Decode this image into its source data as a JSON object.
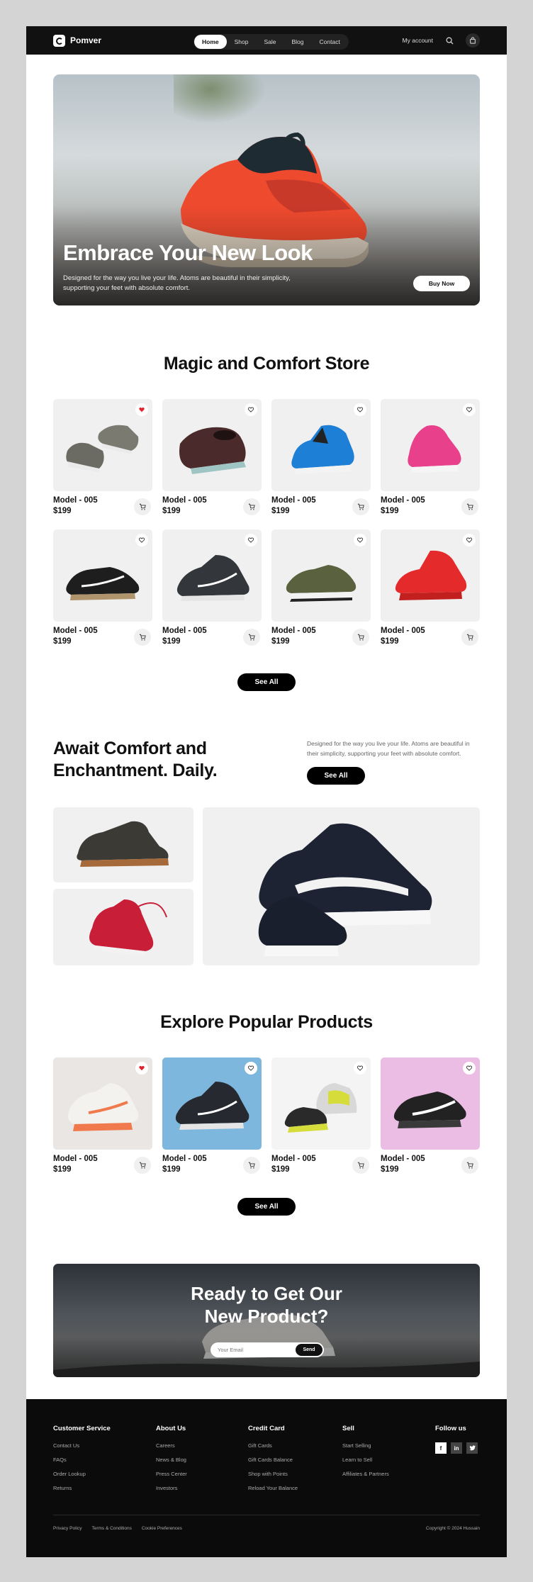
{
  "nav": {
    "brand": "Pomver",
    "links": [
      "Home",
      "Shop",
      "Sale",
      "Blog",
      "Contact"
    ],
    "active": "Home",
    "account": "My account"
  },
  "hero": {
    "title": "Embrace Your New Look",
    "subtitle": "Designed for the way you live your life. Atoms are beautiful in their simplicity, supporting your feet with absolute comfort.",
    "button": "Buy Now"
  },
  "store": {
    "title": "Magic and Comfort Store",
    "products": [
      {
        "name": "Model - 005",
        "price": "$199",
        "liked": true
      },
      {
        "name": "Model - 005",
        "price": "$199",
        "liked": false
      },
      {
        "name": "Model - 005",
        "price": "$199",
        "liked": false
      },
      {
        "name": "Model - 005",
        "price": "$199",
        "liked": false
      },
      {
        "name": "Model - 005",
        "price": "$199",
        "liked": false
      },
      {
        "name": "Model - 005",
        "price": "$199",
        "liked": false
      },
      {
        "name": "Model - 005",
        "price": "$199",
        "liked": false
      },
      {
        "name": "Model - 005",
        "price": "$199",
        "liked": false
      }
    ],
    "see_all": "See All"
  },
  "await": {
    "title_line1": "Await Comfort and",
    "title_line2": "Enchantment. Daily.",
    "description": "Designed for the way you live your life. Atoms are beautiful in their simplicity, supporting your feet with absolute comfort.",
    "button": "See All"
  },
  "popular": {
    "title": "Explore Popular Products",
    "products": [
      {
        "name": "Model - 005",
        "price": "$199",
        "liked": true
      },
      {
        "name": "Model - 005",
        "price": "$199",
        "liked": false
      },
      {
        "name": "Model - 005",
        "price": "$199",
        "liked": false
      },
      {
        "name": "Model - 005",
        "price": "$199",
        "liked": false
      }
    ],
    "see_all": "See All"
  },
  "cta": {
    "title_line1": "Ready to Get Our",
    "title_line2": "New Product?",
    "placeholder": "Your Email",
    "button": "Send"
  },
  "footer": {
    "columns": [
      {
        "title": "Customer Service",
        "links": [
          "Contact Us",
          "FAQs",
          "Order Lookup",
          "Returns"
        ]
      },
      {
        "title": "About Us",
        "links": [
          "Careers",
          "News & Blog",
          "Press Center",
          "Investors"
        ]
      },
      {
        "title": "Credit Card",
        "links": [
          "Gift Cards",
          "Gift Cards Balance",
          "Shop with Points",
          "Reload Your Balance"
        ]
      },
      {
        "title": "Sell",
        "links": [
          "Start Selling",
          "Learn to Sell",
          "Affiliates & Partners"
        ]
      }
    ],
    "follow_title": "Follow us",
    "social": [
      "f",
      "in",
      "t"
    ],
    "bottom_links": [
      "Privacy Policy",
      "Terms & Conditions",
      "Cookie Preferences"
    ],
    "copyright": "Copyright © 2024 Hussain"
  },
  "colors": {
    "accent": "#000000",
    "liked": "#e0232d",
    "card_bg": "#f0f0f0"
  }
}
